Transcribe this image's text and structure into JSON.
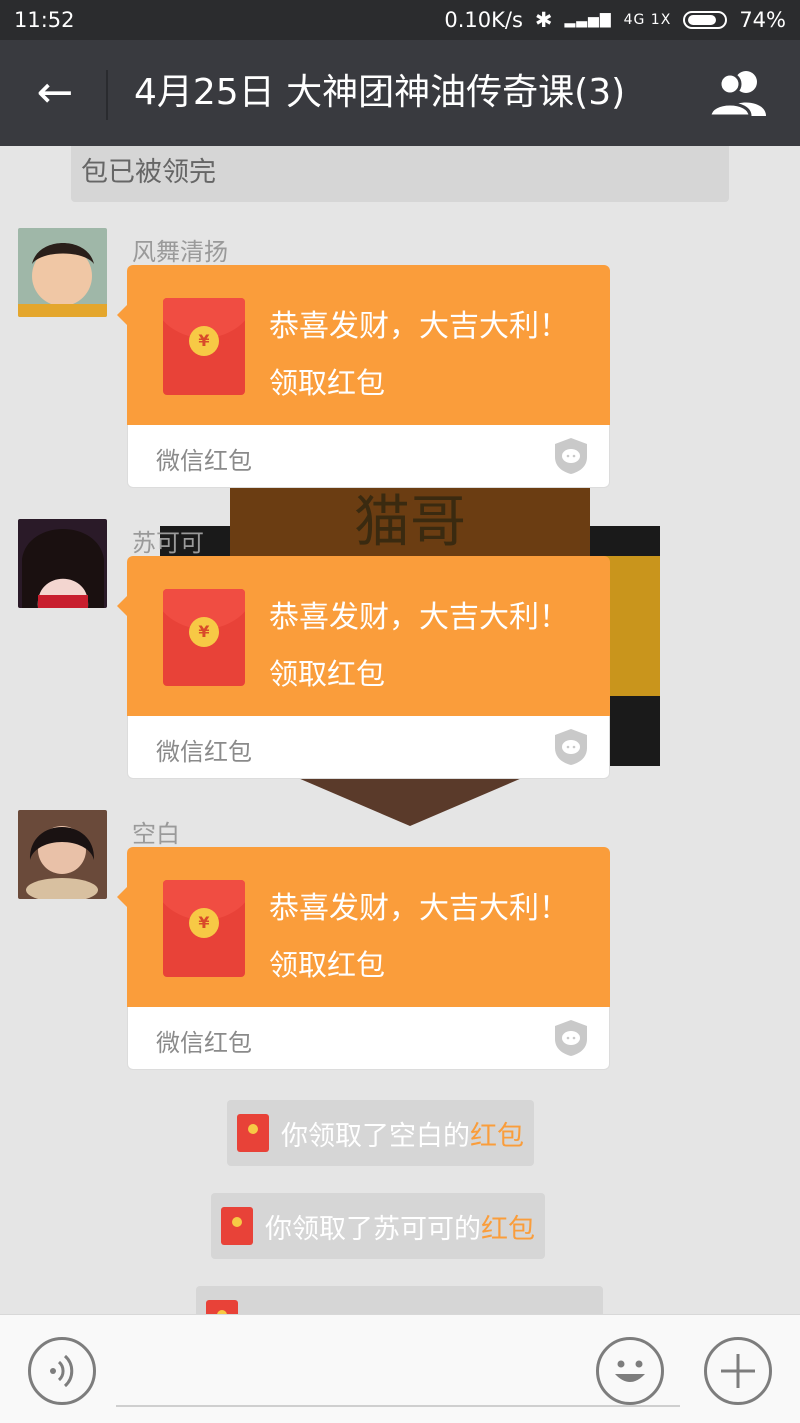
{
  "status_bar": {
    "time": "11:52",
    "speed": "0.10K/s",
    "net_label": "4G 1X",
    "battery": "74%"
  },
  "header": {
    "back_glyph": "←",
    "title": "4月25日  大神团神油传奇课(3)",
    "group_icon": "group-members-icon"
  },
  "previous_notice": "包已被领完",
  "messages": [
    {
      "sender": "风舞清扬",
      "greeting": "恭喜发财，大吉大利！",
      "action": "领取红包",
      "footer": "微信红包"
    },
    {
      "sender": "苏可可",
      "greeting": "恭喜发财，大吉大利！",
      "action": "领取红包",
      "footer": "微信红包"
    },
    {
      "sender": "空白",
      "greeting": "恭喜发财，大吉大利！",
      "action": "领取红包",
      "footer": "微信红包"
    }
  ],
  "background_art_text": "猫哥",
  "system_notices": [
    {
      "prefix": "你领取了空白的",
      "link": "红包"
    },
    {
      "prefix": "你领取了苏可可的",
      "link": "红包"
    }
  ],
  "envelope_symbol": "¥",
  "colors": {
    "bubble": "#fa9d3b",
    "envelope": "#e84238",
    "navbar": "#393a3f",
    "chat_bg": "#e5e5e5"
  },
  "input_bar": {
    "voice_icon": "voice-icon",
    "emoji_icon": "emoji-icon",
    "plus_icon": "plus-icon",
    "value": ""
  }
}
